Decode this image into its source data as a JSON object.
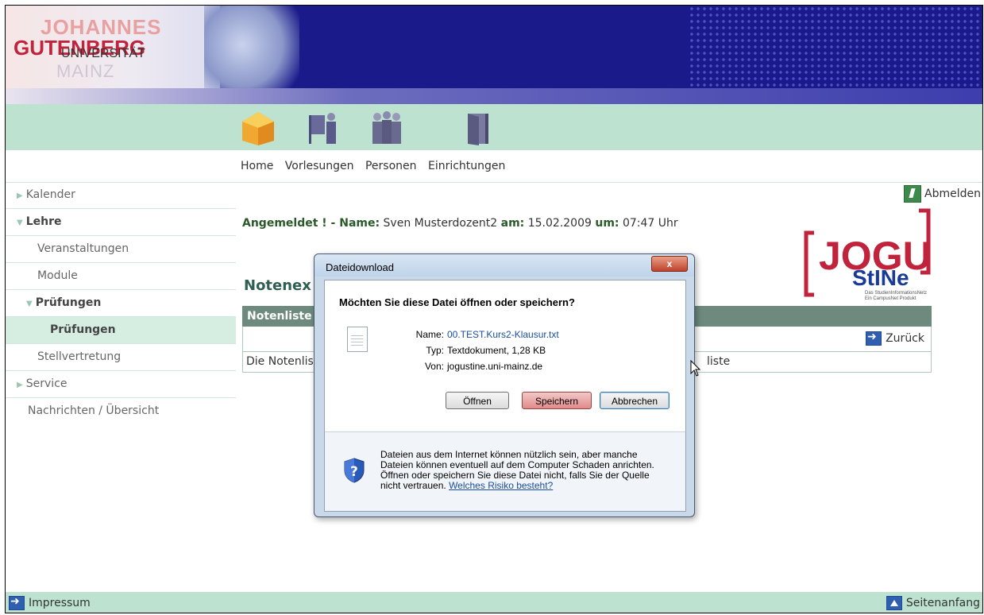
{
  "header": {
    "logo_line1": "JOHANNES",
    "logo_line2": "GUTENBERG",
    "logo_line3": "UNIVERSITÄT",
    "logo_line4": "MAINZ"
  },
  "nav": {
    "items": [
      {
        "label": "Home"
      },
      {
        "label": "Vorlesungen"
      },
      {
        "label": "Personen"
      },
      {
        "label": "Einrichtungen"
      }
    ]
  },
  "sidebar": {
    "items": [
      {
        "label": "Kalender"
      },
      {
        "label": "Lehre"
      },
      {
        "label": "Veranstaltungen"
      },
      {
        "label": "Module"
      },
      {
        "label": "Prüfungen"
      },
      {
        "label": "Prüfungen"
      },
      {
        "label": "Stellvertretung"
      },
      {
        "label": "Service"
      },
      {
        "label": "Nachrichten / Übersicht"
      }
    ]
  },
  "main": {
    "abmelden": "Abmelden",
    "login_label": "Angemeldet ! - Name:",
    "login_name": "Sven Musterdozent2",
    "login_am": "am:",
    "login_date": "15.02.2009",
    "login_um": "um:",
    "login_time": "07:47 Uhr",
    "logo_jogu": "JOGU",
    "logo_stine": "StINe",
    "logo_sub1": "Das StudienInformationsNetz",
    "logo_sub2": "Ein CampusNet Produkt",
    "section_title": "Notenex",
    "table_header": "Notenliste",
    "back_label": "Zurück",
    "list_text_left": "Die Notenlis",
    "list_text_right": "liste"
  },
  "dialog": {
    "title": "Dateidownload",
    "close_label": "x",
    "question": "Möchten Sie diese Datei öffnen oder speichern?",
    "name_label": "Name:",
    "name_value": "00.TEST.Kurs2-Klausur.txt",
    "type_label": "Typ:",
    "type_value": "Textdokument, 1,28 KB",
    "from_label": "Von:",
    "from_value": "jogustine.uni-mainz.de",
    "open_label": "Öffnen",
    "save_label": "Speichern",
    "cancel_label": "Abbrechen",
    "warning_l1": "Dateien aus dem Internet können nützlich sein, aber manche",
    "warning_l2": "Dateien können eventuell auf dem Computer Schaden anrichten.",
    "warning_l3": "Öffnen oder speichern Sie diese Datei nicht, falls Sie der Quelle",
    "warning_l4": "nicht vertrauen.",
    "warning_link": "Welches Risiko besteht?"
  },
  "footer": {
    "impressum": "Impressum",
    "seitenanfang": "Seitenanfang"
  }
}
